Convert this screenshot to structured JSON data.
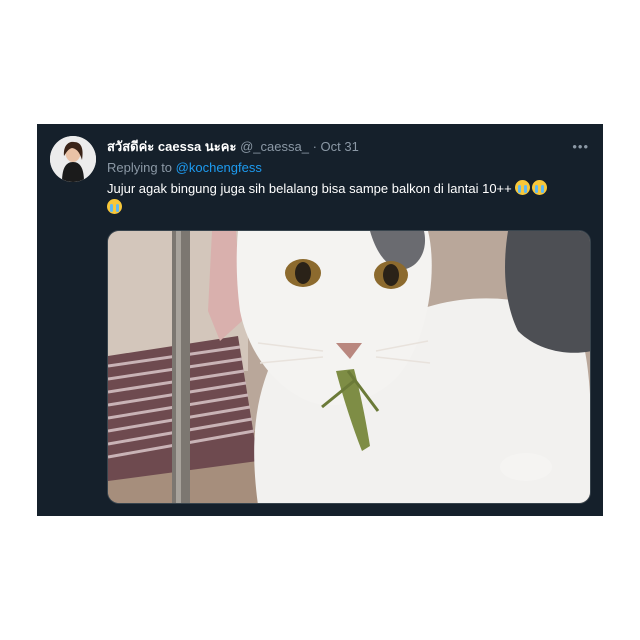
{
  "tweet": {
    "display_name": "สวัสดีค่ะ caessa นะคะ",
    "handle": "@_caessa_",
    "separator": "·",
    "date": "Oct 31",
    "more_label": "•••",
    "replying_prefix": "Replying to ",
    "replying_to": "@kochengfess",
    "text": "Jujur agak bingung juga sih belalang bisa sampe balkon di lantai 10++",
    "emojis": [
      "loudly-crying-face-emoji",
      "loudly-crying-face-emoji",
      "loudly-crying-face-emoji"
    ]
  },
  "colors": {
    "card_background": "#15202b",
    "page_background": "#ffffff",
    "mention": "#1d9bf0",
    "muted": "#8b98a5"
  }
}
